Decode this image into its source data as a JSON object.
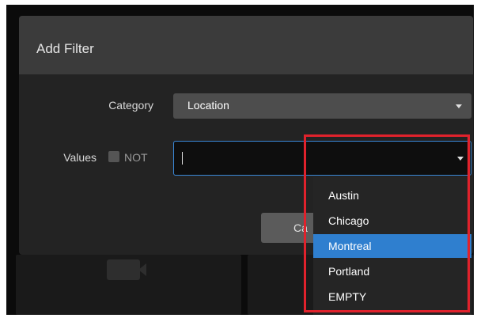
{
  "dialog": {
    "title": "Add Filter",
    "category_label": "Category",
    "category_value": "Location",
    "values_label": "Values",
    "not_label": "NOT",
    "not_checked": false,
    "values_input": "",
    "cancel_label": "Ca"
  },
  "dropdown": {
    "options": [
      "Austin",
      "Chicago",
      "Montreal",
      "Portland",
      "EMPTY"
    ],
    "selected": "Montreal"
  },
  "colors": {
    "accent": "#2f7fcf",
    "highlight_frame": "#e0222c"
  },
  "icons": {
    "category_caret": "chevron-down-icon",
    "values_caret": "chevron-down-icon",
    "camera": "video-camera-icon"
  }
}
